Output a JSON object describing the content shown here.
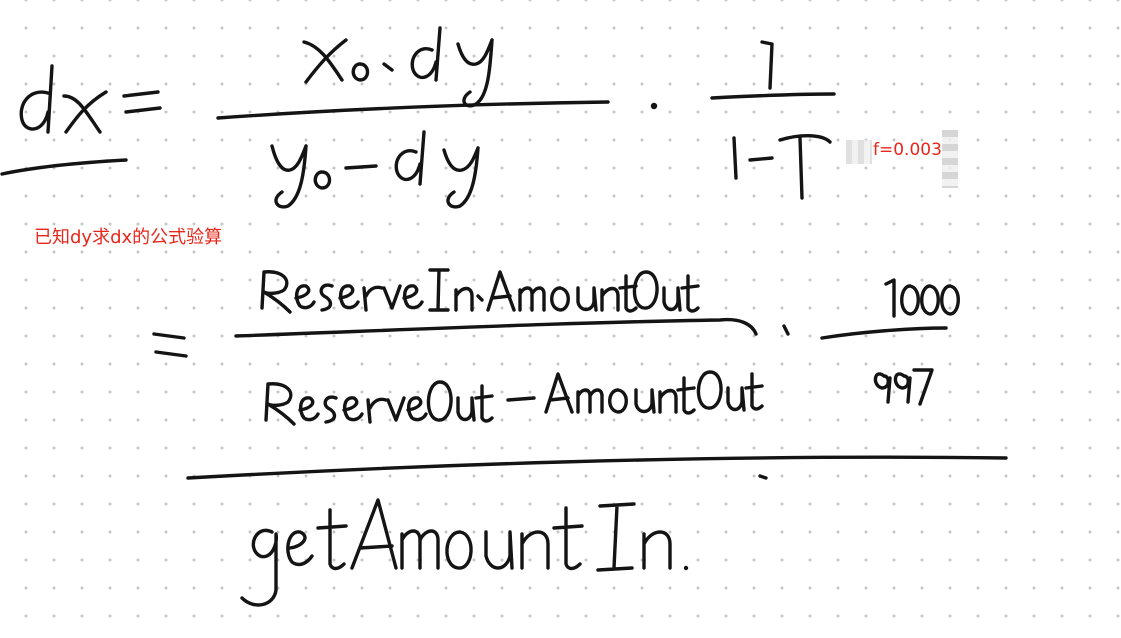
{
  "annotations": {
    "fee_note": "f=0.003",
    "caption": "已知dy求dx的公式验算"
  },
  "colors": {
    "annotation_text": "#e8271b",
    "ink": "#141414",
    "grid_dot": "#c4c4c4"
  }
}
